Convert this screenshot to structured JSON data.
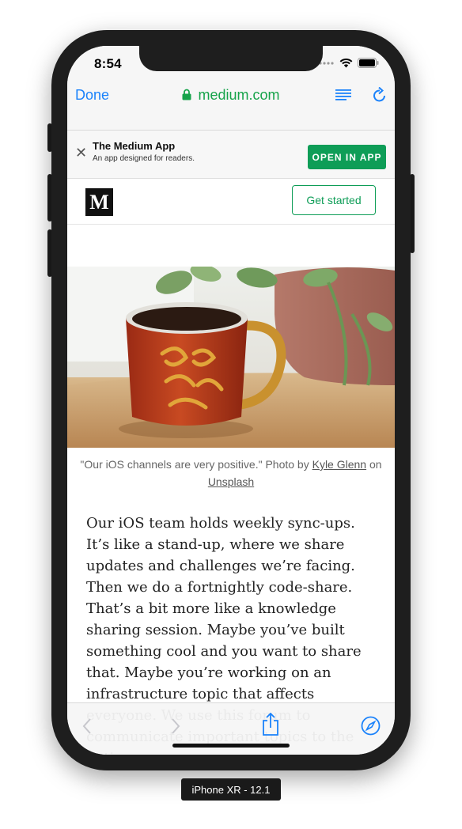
{
  "status_bar": {
    "time": "8:54"
  },
  "browser": {
    "done_label": "Done",
    "url": "medium.com",
    "colors": {
      "accent": "#1a82fb",
      "url_green": "#16a34a"
    }
  },
  "app_banner": {
    "title": "The Medium App",
    "subtitle": "An app designed for readers.",
    "open_label": "OPEN IN APP",
    "button_color": "#0e9d57"
  },
  "site_header": {
    "logo_letter": "M",
    "get_started_label": "Get started"
  },
  "caption": {
    "quote": "\"Our iOS channels are very positive.\" Photo by ",
    "author_link": "Kyle Glenn",
    "on_text": " on",
    "source_link": "Unsplash"
  },
  "article": {
    "body": "Our iOS team holds weekly sync-ups. It’s like a stand-up, where we share updates and challenges we’re facing. Then we do a fortnightly code-share. That’s a bit more like a knowledge sharing session. Maybe you’ve built something cool and you want to share that. Maybe you’re working on an infrastructure topic that affects everyone. We use this forum to communicate important topics to the entire"
  },
  "device_label": "iPhone XR - 12.1",
  "icons": [
    "lock-icon",
    "reader-view-icon",
    "reload-icon",
    "close-icon",
    "back-icon",
    "forward-icon",
    "share-icon",
    "safari-compass-icon",
    "signal-icon",
    "wifi-icon",
    "battery-icon"
  ]
}
